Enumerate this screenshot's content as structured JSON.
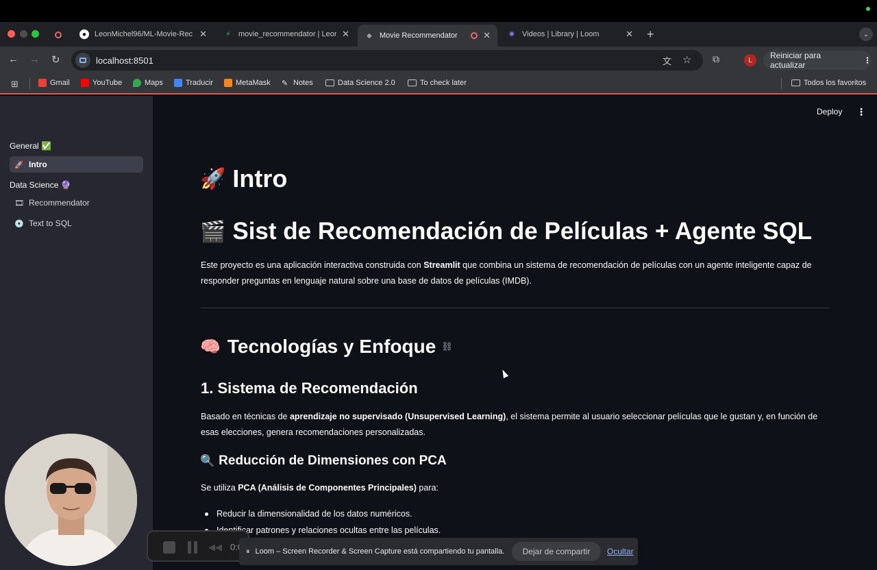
{
  "browser": {
    "tabs": [
      {
        "title": "LeonMichel96/ML-Movie-Rec",
        "favicon": "github-icon"
      },
      {
        "title": "movie_recommendator | Leon",
        "favicon": "streamlit-icon"
      },
      {
        "title": "Movie Recommendator",
        "favicon": "streamlit-icon",
        "active": true
      },
      {
        "title": "Videos | Library | Loom",
        "favicon": "loom-icon"
      }
    ],
    "url": "localhost:8501",
    "update_button": "Reiniciar para actualizar",
    "profile_initial": "L",
    "bookmarks": [
      "Gmail",
      "YouTube",
      "Maps",
      "Traducir",
      "MetaMask",
      "Notes",
      "Data Science 2.0",
      "To check later"
    ],
    "all_bookmarks": "Todos los favoritos"
  },
  "app": {
    "deploy_label": "Deploy",
    "sidebar": {
      "section_general": "General ✅",
      "section_ds": "Data Science 🔮",
      "items": [
        {
          "label": "Intro",
          "icon": "🚀",
          "active": true
        },
        {
          "label": "Recommendator",
          "icon": "🎞"
        },
        {
          "label": "Text to SQL",
          "icon": "💿"
        }
      ]
    },
    "content": {
      "title_intro": "Intro",
      "title_intro_emoji": "🚀",
      "title_sist": "Sist de Recomendación de Películas + Agente SQL",
      "title_sist_emoji": "🎬",
      "intro_para_1": "Este proyecto es una aplicación interactiva construida con ",
      "intro_para_bold": "Streamlit",
      "intro_para_2": " que combina un sistema de recomendación de películas con un agente inteligente capaz de responder preguntas en lenguaje natural sobre una base de datos de películas (IMDB).",
      "tech_title": "Tecnologías y Enfoque",
      "tech_emoji": "🧠",
      "sis_title": "1. Sistema de Recomendación",
      "sis_para_1": "Basado en técnicas de ",
      "sis_para_bold": "aprendizaje no supervisado (Unsupervised Learning)",
      "sis_para_2": ", el sistema permite al usuario seleccionar películas que le gustan y, en función de esas elecciones, genera recomendaciones personalizadas.",
      "pca_title": "Reducción de Dimensiones con PCA",
      "pca_emoji": "🔍",
      "pca_para_1": "Se utiliza ",
      "pca_para_bold": "PCA (Análisis de Componentes Principales)",
      "pca_para_2": " para:",
      "bullets": [
        "Reducir la dimensionalidad de los datos numéricos.",
        "Identificar patrones y relaciones ocultas entre las películas."
      ]
    }
  },
  "loom": {
    "timer": "0:0",
    "share_text": "Loom – Screen Recorder & Screen Capture está compartiendo tu pantalla.",
    "stop_sharing": "Dejar de compartir",
    "hide": "Ocultar"
  }
}
